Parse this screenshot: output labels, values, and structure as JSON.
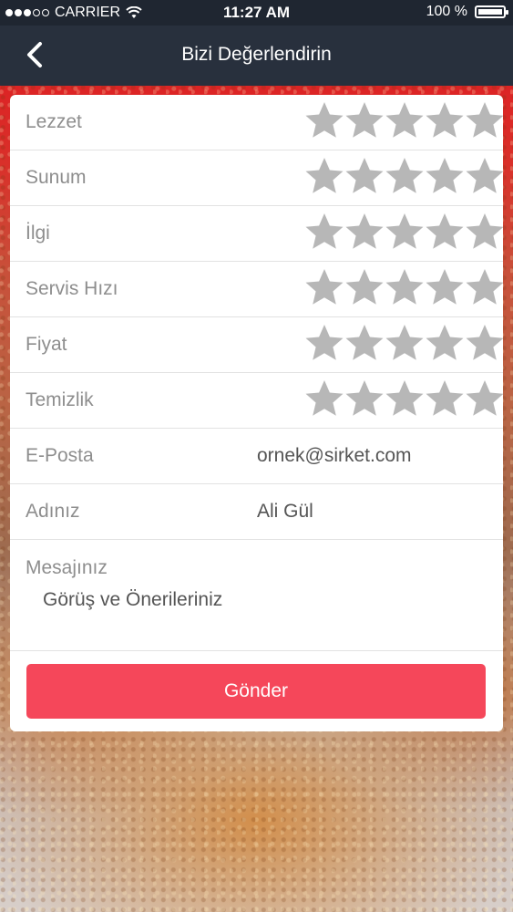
{
  "status_bar": {
    "carrier": "CARRIER",
    "time": "11:27 AM",
    "battery": "100 %",
    "signal_bars_filled": 3,
    "signal_bars_total": 5
  },
  "nav": {
    "title": "Bizi Değerlendirin",
    "back_icon": "chevron-left-icon"
  },
  "ratings": [
    {
      "label": "Lezzet",
      "stars_filled": 0,
      "stars_total": 5
    },
    {
      "label": "Sunum",
      "stars_filled": 0,
      "stars_total": 5
    },
    {
      "label": "İlgi",
      "stars_filled": 0,
      "stars_total": 5
    },
    {
      "label": "Servis Hızı",
      "stars_filled": 0,
      "stars_total": 5
    },
    {
      "label": "Fiyat",
      "stars_filled": 0,
      "stars_total": 5
    },
    {
      "label": "Temizlik",
      "stars_filled": 0,
      "stars_total": 5
    }
  ],
  "fields": {
    "email": {
      "label": "E-Posta",
      "value": "ornek@sirket.com"
    },
    "name": {
      "label": "Adınız",
      "value": "Ali Gül"
    },
    "message": {
      "label": "Mesajınız",
      "value": "Görüş ve Önerileriniz"
    }
  },
  "submit_label": "Gönder",
  "colors": {
    "nav_bg": "#28303d",
    "accent": "#f5475a",
    "star_empty": "#b7b7b7"
  }
}
